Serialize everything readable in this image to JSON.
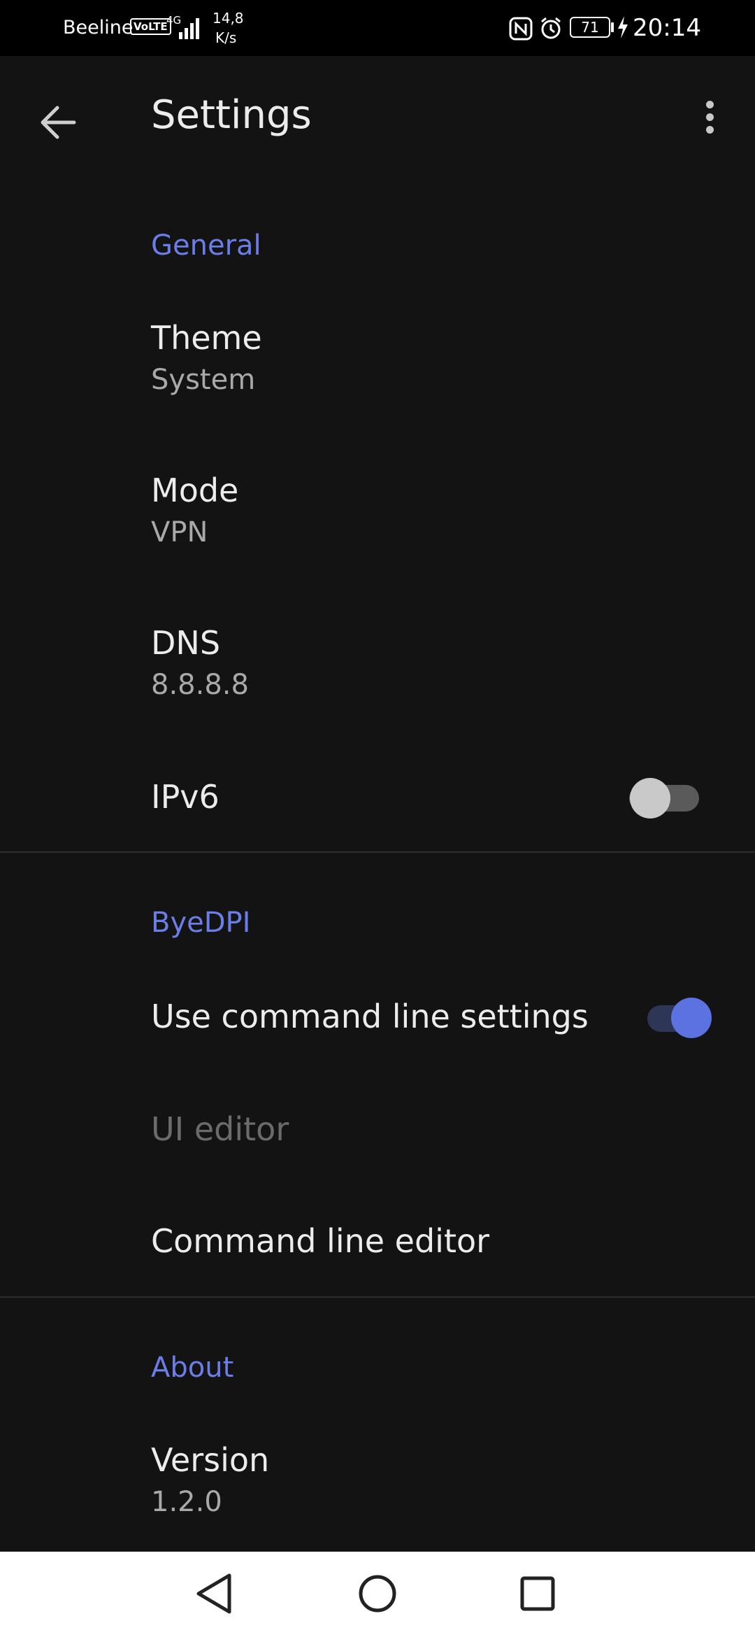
{
  "status_bar": {
    "carrier": "Beeline",
    "volte": "VoLTE",
    "network": "4G",
    "speed_value": "14,8",
    "speed_unit": "K/s",
    "battery": "71",
    "time": "20:14"
  },
  "app_bar": {
    "title": "Settings",
    "back_icon": "arrow-left-icon",
    "menu_icon": "more-vertical-icon"
  },
  "sections": {
    "general": {
      "header": "General",
      "theme": {
        "title": "Theme",
        "summary": "System"
      },
      "mode": {
        "title": "Mode",
        "summary": "VPN"
      },
      "dns": {
        "title": "DNS",
        "summary": "8.8.8.8"
      },
      "ipv6": {
        "title": "IPv6",
        "enabled": false
      }
    },
    "byedpi": {
      "header": "ByeDPI",
      "use_cmd": {
        "title": "Use command line settings",
        "enabled": true
      },
      "ui_editor": {
        "title": "UI editor",
        "disabled": true
      },
      "cmd_editor": {
        "title": "Command line editor"
      }
    },
    "about": {
      "header": "About",
      "version": {
        "title": "Version",
        "summary": "1.2.0"
      }
    }
  },
  "colors": {
    "background": "#131313",
    "accent": "#6b7ee8",
    "switch_on_thumb": "#5b72e0",
    "switch_on_track": "#2e3657",
    "switch_off_thumb": "#c9c9c9",
    "switch_off_track": "#5a5a5a"
  },
  "nav_bar": {
    "back_icon": "nav-back-triangle-icon",
    "home_icon": "nav-home-circle-icon",
    "recents_icon": "nav-recents-square-icon"
  }
}
